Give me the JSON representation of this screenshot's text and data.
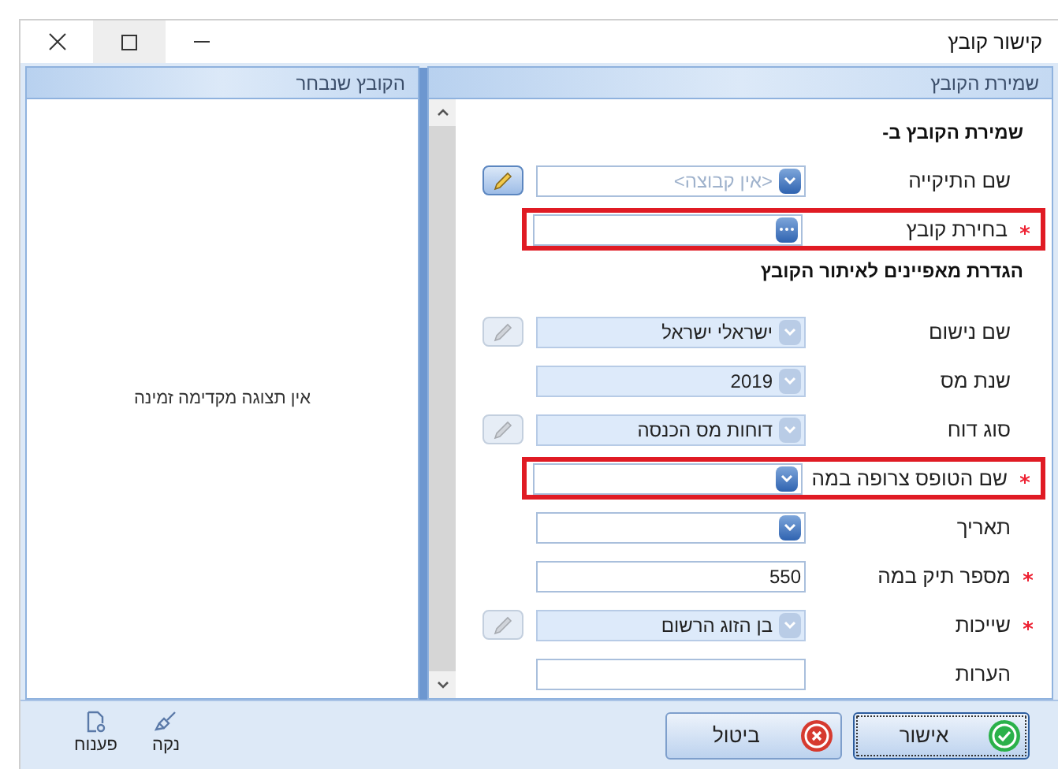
{
  "window": {
    "title": "קישור קובץ"
  },
  "form_panel": {
    "title": "שמירת הקובץ",
    "sections": [
      {
        "heading": "שמירת הקובץ ב-",
        "fields": [
          {
            "label": "שם התיקייה",
            "required": false,
            "highlighted": false,
            "kind": "combo",
            "disabled": false,
            "placeholder": "<אין קבוצה>",
            "edit_button": {
              "disabled": false
            }
          },
          {
            "label": "בחירת קובץ",
            "required": true,
            "highlighted": true,
            "kind": "browse",
            "disabled": false
          }
        ]
      },
      {
        "heading": "הגדרת מאפיינים לאיתור הקובץ",
        "fields": [
          {
            "label": "שם נישום",
            "required": false,
            "highlighted": false,
            "kind": "combo",
            "disabled": true,
            "value": "ישראלי ישראל",
            "edit_button": {
              "disabled": true
            }
          },
          {
            "label": "שנת מס",
            "required": false,
            "highlighted": false,
            "kind": "combo",
            "disabled": true,
            "value": "2019"
          },
          {
            "label": "סוג דוח",
            "required": false,
            "highlighted": false,
            "kind": "combo",
            "disabled": true,
            "value": "דוחות מס הכנסה",
            "edit_button": {
              "disabled": true
            }
          },
          {
            "label": "שם הטופס צרופה במה",
            "required": true,
            "highlighted": true,
            "kind": "combo",
            "disabled": false
          },
          {
            "label": "תאריך",
            "required": false,
            "highlighted": false,
            "kind": "combo",
            "disabled": false
          },
          {
            "label": "מספר תיק במה",
            "required": true,
            "highlighted": false,
            "kind": "text",
            "disabled": false,
            "value": "550"
          },
          {
            "label": "שייכות",
            "required": true,
            "highlighted": false,
            "kind": "combo",
            "disabled": true,
            "value": "בן הזוג הרשום",
            "edit_button": {
              "disabled": true
            }
          },
          {
            "label": "הערות",
            "required": false,
            "highlighted": false,
            "kind": "text",
            "disabled": false
          }
        ]
      }
    ]
  },
  "preview_panel": {
    "title": "הקובץ שנבחר",
    "message": "אין תצוגה מקדימה זמינה"
  },
  "footer": {
    "buttons": [
      {
        "label": "אישור",
        "kind": "ok"
      },
      {
        "label": "ביטול",
        "kind": "cancel"
      }
    ],
    "tools": [
      {
        "label": "נקה",
        "kind": "clear"
      },
      {
        "label": "פענוח",
        "kind": "decode"
      }
    ]
  }
}
